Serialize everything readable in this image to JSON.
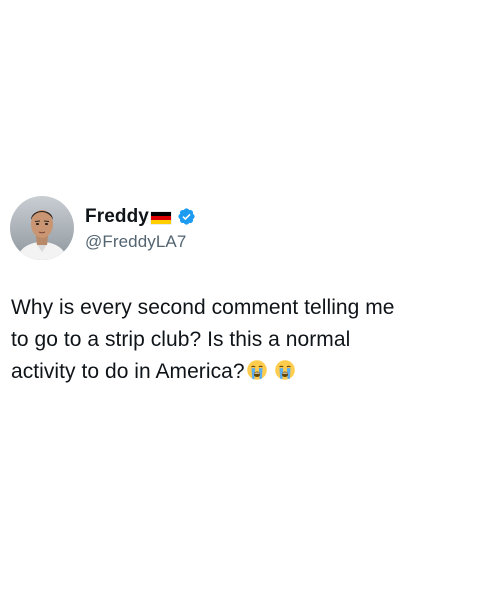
{
  "tweet": {
    "author": {
      "display_name": "Freddy",
      "handle": "@FreddyLA7",
      "flag_icon": "germany-flag-icon",
      "flag_colors": [
        "#000000",
        "#dd0000",
        "#ffce00"
      ],
      "verified_icon": "verified-badge-icon",
      "verified_color": "#1d9bf0"
    },
    "text_line_1": "Why is every second comment telling me",
    "text_line_2": "to go to a strip club? Is this a normal",
    "text_line_3": "activity to do in America?",
    "emojis": [
      "loudly-crying-face-icon",
      "loudly-crying-face-icon"
    ]
  },
  "colors": {
    "text_primary": "#0f1419",
    "text_secondary": "#536471",
    "background": "#ffffff"
  }
}
